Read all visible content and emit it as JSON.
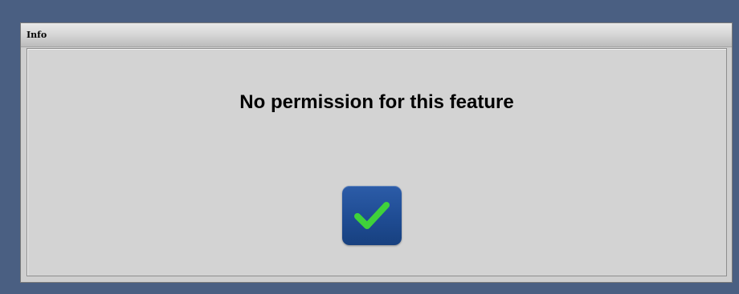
{
  "dialog": {
    "title": "Info",
    "message": "No permission for this feature",
    "confirm_icon": "checkmark-icon",
    "confirm_color": "#3fd23a",
    "button_color": "#1f4c93"
  }
}
